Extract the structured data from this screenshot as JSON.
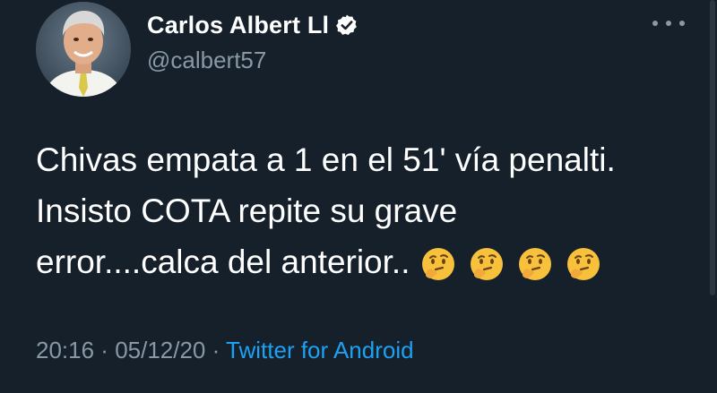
{
  "author": {
    "display_name": "Carlos Albert Ll",
    "handle": "@calbert57",
    "verified": true,
    "avatar_icon": "profile-photo"
  },
  "tweet": {
    "lines": [
      "Chivas empata a 1 en el 51' vía penalti.",
      "Insisto COTA repite su grave",
      "error....calca del anterior.."
    ],
    "emojis": [
      "thinking-face",
      "thinking-face",
      "thinking-face",
      "thinking-face"
    ]
  },
  "meta": {
    "time": "20:16",
    "separator1": " · ",
    "date": "05/12/20",
    "separator2": " · ",
    "source": "Twitter for Android"
  },
  "colors": {
    "background": "#15202b",
    "text": "#ffffff",
    "muted": "#8899a6",
    "link": "#1da1f2",
    "verified": "#ffffff"
  },
  "icons": {
    "more": "more-options-icon",
    "verified": "verified-badge-icon"
  }
}
